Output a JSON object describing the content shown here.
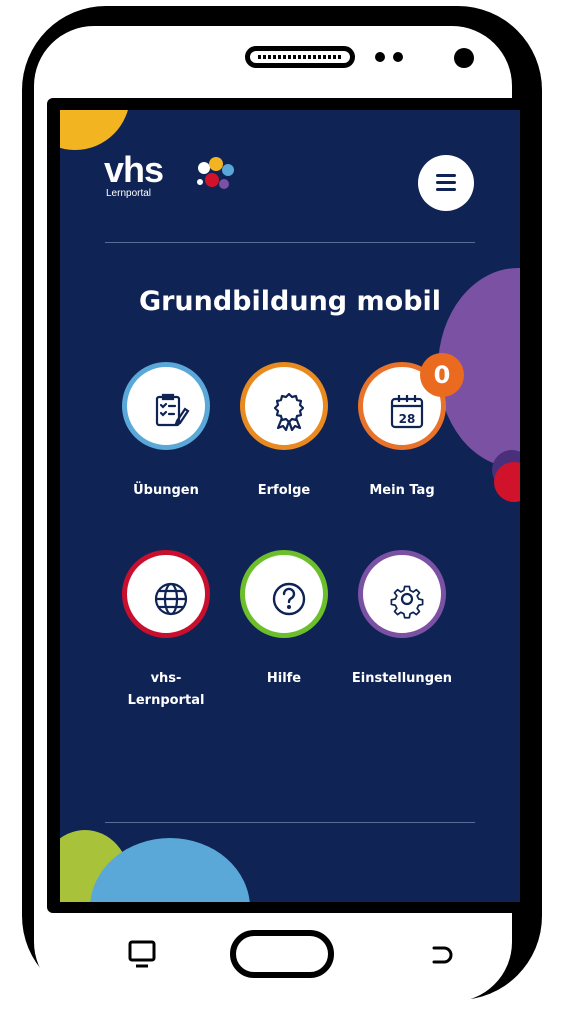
{
  "app": {
    "logo_text": "vhs",
    "logo_subtitle": "Lernportal",
    "title": "Grundbildung mobil"
  },
  "menu": {
    "icon": "hamburger-menu-icon"
  },
  "tiles": [
    {
      "label": "Übungen",
      "icon": "clipboard-check-icon",
      "ring_color": "#5aa8d8"
    },
    {
      "label": "Erfolge",
      "icon": "award-ribbon-icon",
      "ring_color": "#e88a1f"
    },
    {
      "label": "Mein Tag",
      "icon": "calendar-icon",
      "ring_color": "#e8722a",
      "calendar_day": "28",
      "badge": "0"
    },
    {
      "label": "vhs-\nLernportal",
      "icon": "globe-icon",
      "ring_color": "#c8102e"
    },
    {
      "label": "Hilfe",
      "icon": "help-question-icon",
      "ring_color": "#6cbf2a"
    },
    {
      "label": "Einstellungen",
      "icon": "gear-icon",
      "ring_color": "#7b51a4"
    }
  ],
  "colors": {
    "background": "#0f2355",
    "accent_orange": "#ea6a1f"
  },
  "phone_nav": {
    "back_icon": "screen-cast-icon",
    "home_button": "home-button",
    "recent_icon": "return-icon"
  }
}
